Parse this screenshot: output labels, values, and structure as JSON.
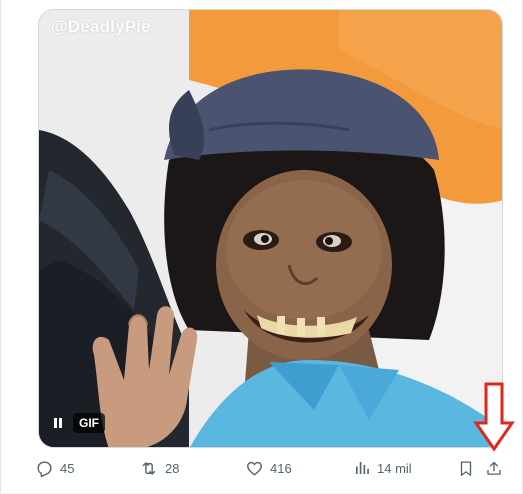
{
  "media": {
    "watermark": "@DeadlyPie",
    "gif_badge": "GIF",
    "pause_icon": "pause-icon"
  },
  "actions": {
    "reply": {
      "icon": "reply-icon",
      "count": "45"
    },
    "repost": {
      "icon": "repost-icon",
      "count": "28"
    },
    "like": {
      "icon": "heart-icon",
      "count": "416"
    },
    "views": {
      "icon": "views-icon",
      "count": "14 mil"
    },
    "bookmark": {
      "icon": "bookmark-icon"
    },
    "share": {
      "icon": "share-icon"
    }
  },
  "annotation": {
    "color": "#e1261c"
  },
  "colors": {
    "action_gray": "#536471",
    "sky_orange": "#f39a3c"
  }
}
